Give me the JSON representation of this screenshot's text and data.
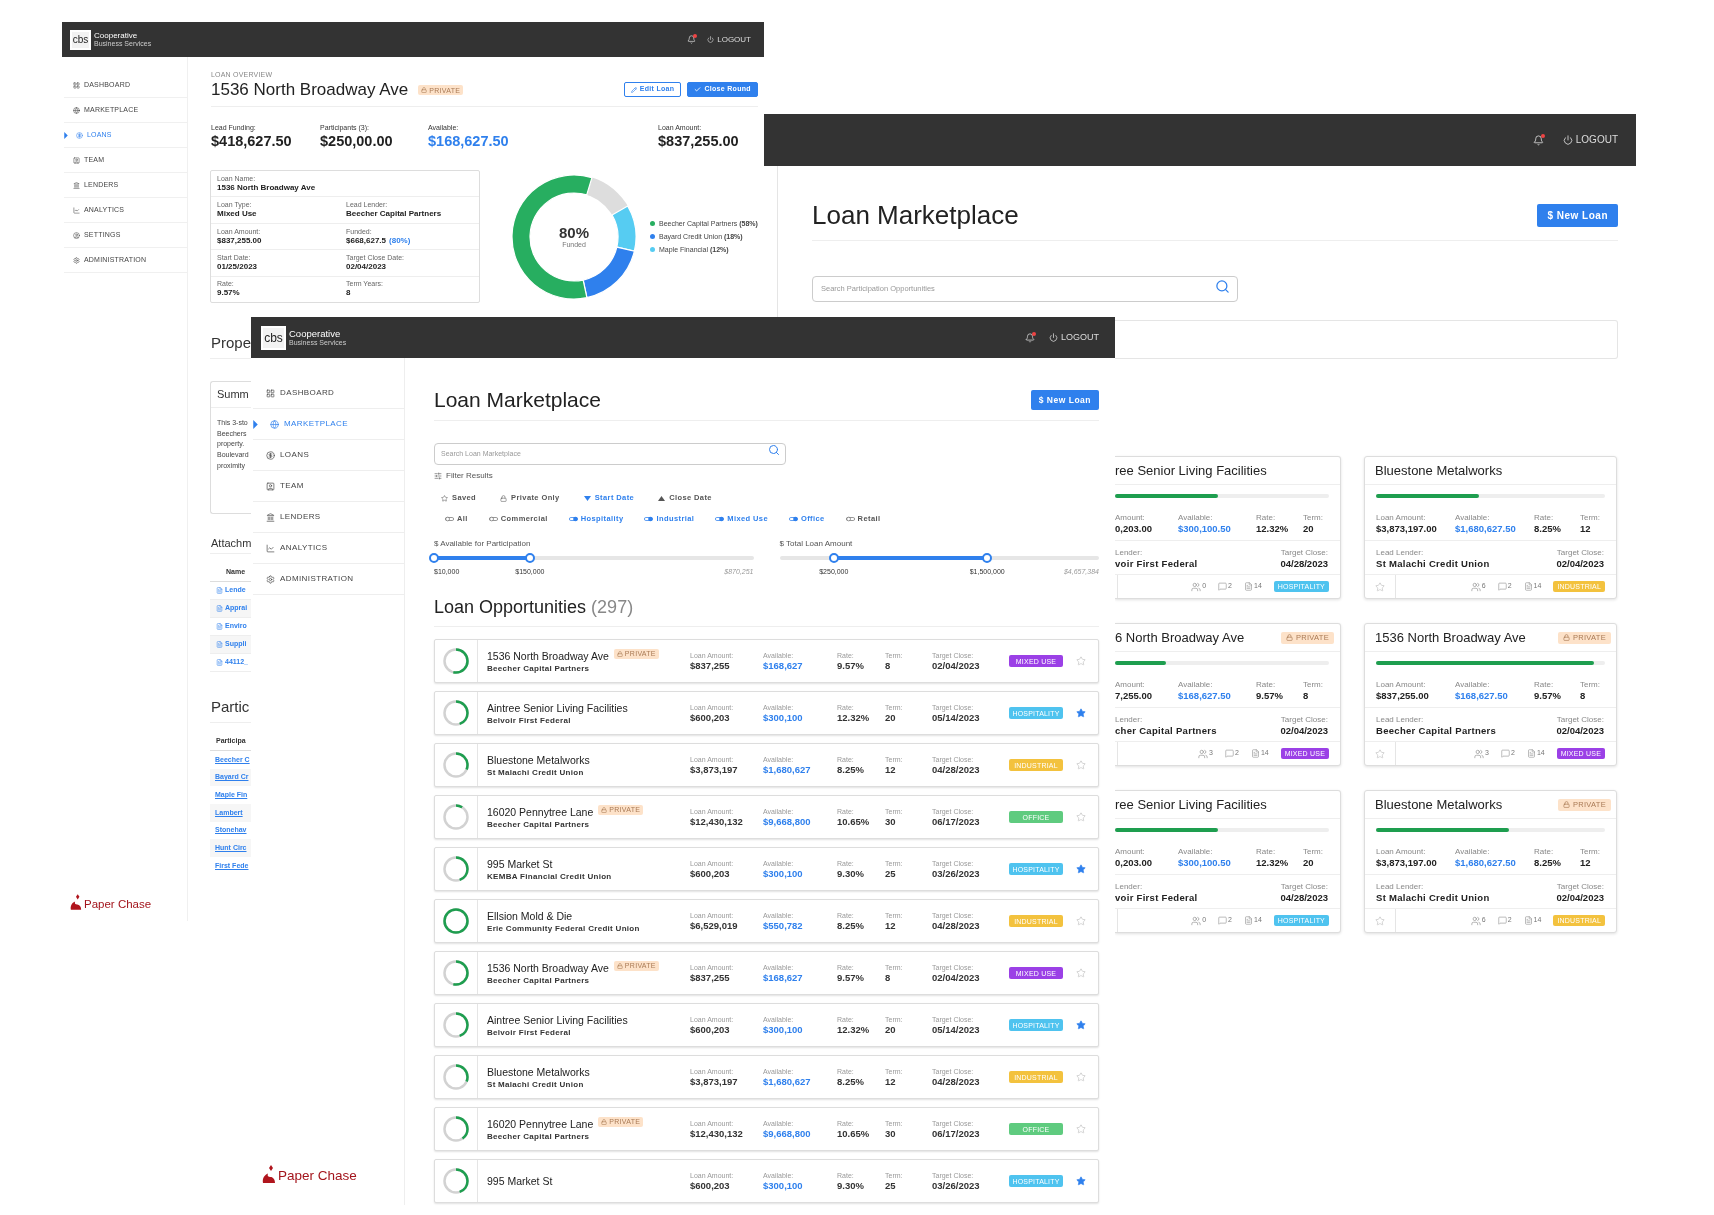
{
  "overview_window": {
    "header": {
      "logo": "cbs",
      "brand": "Cooperative",
      "tagline": "Business Services",
      "alert": true,
      "logout": "LOGOUT"
    },
    "sidebar": [
      {
        "label": "DASHBOARD",
        "selected": false
      },
      {
        "label": "MARKETPLACE",
        "selected": false
      },
      {
        "label": "LOANS",
        "selected": true
      },
      {
        "label": "TEAM",
        "selected": false
      },
      {
        "label": "LENDERS",
        "selected": false
      },
      {
        "label": "ANALYTICS",
        "selected": false
      },
      {
        "label": "SETTINGS",
        "selected": false
      },
      {
        "label": "ADMINISTRATION",
        "selected": false
      }
    ],
    "footer_logo": "Paper Chase",
    "eyebrow": "LOAN OVERVIEW",
    "title": "1536 North Broadway Ave",
    "badge": "PRIVATE",
    "buttons": [
      {
        "label": "Edit Loan",
        "kind": "outline"
      },
      {
        "label": "Close Round",
        "kind": "primary"
      }
    ],
    "stats": [
      {
        "label": "Lead Funding:",
        "value": "$418,627.50",
        "accent": false
      },
      {
        "label": "Participants (3):",
        "value": "$250,00.00",
        "accent": false
      },
      {
        "label": "Available:",
        "value": "$168,627.50",
        "accent": true
      },
      {
        "label": "Loan Amount:",
        "value": "$837,255.00",
        "accent": false
      }
    ],
    "details": [
      {
        "cells": [
          {
            "label": "Loan Name:",
            "value": "1536 North Broadway Ave"
          }
        ]
      },
      {
        "cells": [
          {
            "label": "Loan Type:",
            "value": "Mixed Use"
          },
          {
            "label": "Lead Lender:",
            "value": "Beecher Capital Partners"
          }
        ]
      },
      {
        "cells": [
          {
            "label": "Loan Amount:",
            "value": "$837,255.00"
          },
          {
            "label": "Funded:",
            "value": "$668,627.5",
            "note": "(80%)"
          }
        ]
      },
      {
        "cells": [
          {
            "label": "Start Date:",
            "value": "01/25/2023"
          },
          {
            "label": "Target Close Date:",
            "value": "02/04/2023"
          }
        ]
      },
      {
        "cells": [
          {
            "label": "Rate:",
            "value": "9.57%"
          },
          {
            "label": "Term Years:",
            "value": "8"
          }
        ]
      }
    ],
    "funding": {
      "center": "80%",
      "caption": "Funded",
      "chart_data": {
        "type": "donut",
        "categories": [
          "Beecher Capital Partners",
          "Bayard Credit Union",
          "Maple Financial"
        ],
        "values": [
          58,
          18,
          12
        ],
        "colors": [
          "#27ae60",
          "#2f80ed",
          "#56ccf2"
        ],
        "value_labels": [
          "(58%)",
          "(18%)",
          "(12%)"
        ],
        "legend": "right"
      }
    },
    "property_heading": "Prope",
    "summary": {
      "title": "Summ",
      "lines": [
        "This 3-sto",
        "Beechers",
        "property.",
        "Boulevard",
        "proximity"
      ]
    },
    "attachments": {
      "title": "Attachm",
      "column": "Name",
      "files": [
        "Lende",
        "Apprai",
        "Enviro",
        "Suppli",
        "44112_"
      ]
    },
    "participants": {
      "title": "Partic",
      "column": "Participa",
      "names": [
        "Beecher C",
        "Bayard Cr",
        "Maple Fin",
        "Lambert",
        "Stonehav",
        "Hunt Circ",
        "First Fede"
      ]
    }
  },
  "participation_window": {
    "header": {
      "alert": true,
      "logout": "LOGOUT"
    },
    "title": "Loan Marketplace",
    "action": "$ New Loan",
    "search": {
      "placeholder": "Search Participation Opportunities"
    },
    "cards": [
      {
        "title": "ree Senior Living Facilities",
        "level": 0.48,
        "stats": [
          {
            "label": "Amount:",
            "value": "0,203.00"
          },
          {
            "label": "Available:",
            "value": "$300,100.50"
          },
          {
            "label": "Rate:",
            "value": "12.32%"
          },
          {
            "label": "Term:",
            "value": "20"
          }
        ],
        "lender": {
          "label": "Lender:",
          "value": "voir First Federal"
        },
        "close": {
          "label": "Target Close:",
          "value": "04/28/2023"
        },
        "counts": [
          "0",
          "2",
          "14"
        ],
        "tag": {
          "text": "HOSPITALITY",
          "color": "#4fc3ef"
        }
      },
      {
        "title": "Bluestone Metalworks",
        "level": 0.45,
        "stats": [
          {
            "label": "Loan Amount:",
            "value": "$3,873,197.00"
          },
          {
            "label": "Available:",
            "value": "$1,680,627.50"
          },
          {
            "label": "Rate:",
            "value": "8.25%"
          },
          {
            "label": "Term:",
            "value": "12"
          }
        ],
        "lender": {
          "label": "Lead Lender:",
          "value": "St Malachi Credit Union"
        },
        "close": {
          "label": "Target Close:",
          "value": "02/04/2023"
        },
        "saved": false,
        "counts": [
          "6",
          "2",
          "14"
        ],
        "tag": {
          "text": "INDUSTRIAL",
          "color": "#f3c23e"
        }
      },
      {
        "title": "6 North Broadway Ave",
        "badge": "PRIVATE",
        "level": 0.24,
        "stats": [
          {
            "label": "Amount:",
            "value": "7,255.00"
          },
          {
            "label": "Available:",
            "value": "$168,627.50"
          },
          {
            "label": "Rate:",
            "value": "9.57%"
          },
          {
            "label": "Term:",
            "value": "8"
          }
        ],
        "lender": {
          "label": "Lender:",
          "value": "cher Capital Partners"
        },
        "close": {
          "label": "Target Close:",
          "value": "02/04/2023"
        },
        "counts": [
          "3",
          "2",
          "14"
        ],
        "tag": {
          "text": "MIXED USE",
          "color": "#9b40e6"
        }
      },
      {
        "title": "1536 North Broadway Ave",
        "badge": "PRIVATE",
        "level": 0.95,
        "stats": [
          {
            "label": "Loan Amount:",
            "value": "$837,255.00"
          },
          {
            "label": "Available:",
            "value": "$168,627.50"
          },
          {
            "label": "Rate:",
            "value": "9.57%"
          },
          {
            "label": "Term:",
            "value": "8"
          }
        ],
        "lender": {
          "label": "Lead Lender:",
          "value": "Beecher Capital Partners"
        },
        "close": {
          "label": "Target Close:",
          "value": "02/04/2023"
        },
        "saved": false,
        "counts": [
          "3",
          "2",
          "14"
        ],
        "tag": {
          "text": "MIXED USE",
          "color": "#9b40e6"
        }
      },
      {
        "title": "ree Senior Living Facilities",
        "level": 0.48,
        "stats": [
          {
            "label": "Amount:",
            "value": "0,203.00"
          },
          {
            "label": "Available:",
            "value": "$300,100.50"
          },
          {
            "label": "Rate:",
            "value": "12.32%"
          },
          {
            "label": "Term:",
            "value": "20"
          }
        ],
        "lender": {
          "label": "Lender:",
          "value": "voir First Federal"
        },
        "close": {
          "label": "Target Close:",
          "value": "04/28/2023"
        },
        "counts": [
          "0",
          "2",
          "14"
        ],
        "tag": {
          "text": "HOSPITALITY",
          "color": "#4fc3ef"
        }
      },
      {
        "title": "Bluestone Metalworks",
        "badge": "PRIVATE",
        "level": 0.58,
        "stats": [
          {
            "label": "Loan Amount:",
            "value": "$3,873,197.00"
          },
          {
            "label": "Available:",
            "value": "$1,680,627.50"
          },
          {
            "label": "Rate:",
            "value": "8.25%"
          },
          {
            "label": "Term:",
            "value": "12"
          }
        ],
        "lender": {
          "label": "Lead Lender:",
          "value": "St Malachi Credit Union"
        },
        "close": {
          "label": "Target Close:",
          "value": "02/04/2023"
        },
        "saved": false,
        "counts": [
          "6",
          "2",
          "14"
        ],
        "tag": {
          "text": "INDUSTRIAL",
          "color": "#f3c23e"
        }
      }
    ]
  },
  "marketplace_window": {
    "header": {
      "logo": "cbs",
      "brand": "Cooperative",
      "tagline": "Business Services",
      "alert": true,
      "logout": "LOGOUT"
    },
    "sidebar": [
      {
        "label": "DASHBOARD",
        "selected": false
      },
      {
        "label": "MARKETPLACE",
        "selected": true
      },
      {
        "label": "LOANS",
        "selected": false
      },
      {
        "label": "TEAM",
        "selected": false
      },
      {
        "label": "LENDERS",
        "selected": false
      },
      {
        "label": "ANALYTICS",
        "selected": false
      },
      {
        "label": "ADMINISTRATION",
        "selected": false
      }
    ],
    "footer_logo": "Paper Chase",
    "title": "Loan Marketplace",
    "action": "$ New Loan",
    "search": {
      "placeholder": "Search Loan Marketplace"
    },
    "filter_heading": "Filter Results",
    "sorts": [
      {
        "label": "Saved",
        "selected": false
      },
      {
        "label": "Private Only",
        "selected": false
      },
      {
        "label": "Start Date",
        "selected": true
      },
      {
        "label": "Close Date",
        "selected": false
      }
    ],
    "types": [
      {
        "label": "All",
        "on": false
      },
      {
        "label": "Commercial",
        "on": false
      },
      {
        "label": "Hospitality",
        "on": true
      },
      {
        "label": "Industrial",
        "on": true
      },
      {
        "label": "Mixed Use",
        "on": true
      },
      {
        "label": "Office",
        "on": true
      },
      {
        "label": "Retail",
        "on": false
      }
    ],
    "ranges": [
      {
        "label": "$ Available for Participation",
        "thumbs": [
          {
            "level": 0,
            "label": "$10,000"
          },
          {
            "level": 0.3,
            "label": "$150,000"
          }
        ],
        "max": "$870,251"
      },
      {
        "label": "$ Total Loan Amount",
        "thumbs": [
          {
            "level": 0.17,
            "label": "$250,000"
          },
          {
            "level": 0.65,
            "label": "$1,500,000"
          }
        ],
        "max": "$4,657,384"
      }
    ],
    "list_title": "Loan Opportunities",
    "count": "(297)",
    "loans": [
      {
        "level": 0.6,
        "title": "1536 North Broadway Ave",
        "badge": "PRIVATE",
        "lender": "Beecher Capital Partners",
        "cells": [
          {
            "label": "Loan Amount:",
            "value": "$837,255"
          },
          {
            "label": "Available:",
            "value": "$168,627"
          },
          {
            "label": "Rate:",
            "value": "9.57%"
          },
          {
            "label": "Term:",
            "value": "8"
          },
          {
            "label": "Target Close:",
            "value": "02/04/2023"
          }
        ],
        "tag": {
          "text": "MIXED USE",
          "color": "#9b40e6"
        },
        "saved": false
      },
      {
        "level": 0.5,
        "title": "Aintree Senior Living Facilities",
        "lender": "Belvoir First Federal",
        "cells": [
          {
            "label": "Loan Amount:",
            "value": "$600,203"
          },
          {
            "label": "Available:",
            "value": "$300,100"
          },
          {
            "label": "Rate:",
            "value": "12.32%"
          },
          {
            "label": "Term:",
            "value": "20"
          },
          {
            "label": "Target Close:",
            "value": "05/14/2023"
          }
        ],
        "tag": {
          "text": "HOSPITALITY",
          "color": "#4fc3ef"
        },
        "saved": true
      },
      {
        "level": 0.35,
        "title": "Bluestone Metalworks",
        "lender": "St Malachi Credit Union",
        "cells": [
          {
            "label": "Loan Amount:",
            "value": "$3,873,197"
          },
          {
            "label": "Available:",
            "value": "$1,680,627"
          },
          {
            "label": "Rate:",
            "value": "8.25%"
          },
          {
            "label": "Term:",
            "value": "12"
          },
          {
            "label": "Target Close:",
            "value": "04/28/2023"
          }
        ],
        "tag": {
          "text": "INDUSTRIAL",
          "color": "#f3c23e"
        },
        "saved": false
      },
      {
        "level": 0.1,
        "title": "16020 Pennytree Lane",
        "badge": "PRIVATE",
        "lender": "Beecher Capital Partners",
        "cells": [
          {
            "label": "Loan Amount:",
            "value": "$12,430,132"
          },
          {
            "label": "Available:",
            "value": "$9,668,800"
          },
          {
            "label": "Rate:",
            "value": "10.65%"
          },
          {
            "label": "Term:",
            "value": "30"
          },
          {
            "label": "Target Close:",
            "value": "06/17/2023"
          }
        ],
        "tag": {
          "text": "OFFICE",
          "color": "#5fcb7f"
        },
        "saved": false
      },
      {
        "level": 0.5,
        "title": "995 Market St",
        "lender": "KEMBA Financial Credit Union",
        "cells": [
          {
            "label": "Loan Amount:",
            "value": "$600,203"
          },
          {
            "label": "Available:",
            "value": "$300,100"
          },
          {
            "label": "Rate:",
            "value": "9.30%"
          },
          {
            "label": "Term:",
            "value": "25"
          },
          {
            "label": "Target Close:",
            "value": "03/26/2023"
          }
        ],
        "tag": {
          "text": "HOSPITALITY",
          "color": "#4fc3ef"
        },
        "saved": true
      },
      {
        "level": 1,
        "title": "Ellsion Mold & Die",
        "lender": "Erie Community Federal Credit Union",
        "cells": [
          {
            "label": "Loan Amount:",
            "value": "$6,529,019"
          },
          {
            "label": "Available:",
            "value": "$550,782"
          },
          {
            "label": "Rate:",
            "value": "8.25%"
          },
          {
            "label": "Term:",
            "value": "12"
          },
          {
            "label": "Target Close:",
            "value": "04/28/2023"
          }
        ],
        "tag": {
          "text": "INDUSTRIAL",
          "color": "#f3c23e"
        },
        "saved": false
      },
      {
        "level": 0.6,
        "title": "1536 North Broadway Ave",
        "badge": "PRIVATE",
        "lender": "Beecher Capital Partners",
        "cells": [
          {
            "label": "Loan Amount:",
            "value": "$837,255"
          },
          {
            "label": "Available:",
            "value": "$168,627"
          },
          {
            "label": "Rate:",
            "value": "9.57%"
          },
          {
            "label": "Term:",
            "value": "8"
          },
          {
            "label": "Target Close:",
            "value": "02/04/2023"
          }
        ],
        "tag": {
          "text": "MIXED USE",
          "color": "#9b40e6"
        },
        "saved": false
      },
      {
        "level": 0.5,
        "title": "Aintree Senior Living Facilities",
        "lender": "Belvoir First Federal",
        "cells": [
          {
            "label": "Loan Amount:",
            "value": "$600,203"
          },
          {
            "label": "Available:",
            "value": "$300,100"
          },
          {
            "label": "Rate:",
            "value": "12.32%"
          },
          {
            "label": "Term:",
            "value": "20"
          },
          {
            "label": "Target Close:",
            "value": "05/14/2023"
          }
        ],
        "tag": {
          "text": "HOSPITALITY",
          "color": "#4fc3ef"
        },
        "saved": true
      },
      {
        "level": 0.35,
        "title": "Bluestone Metalworks",
        "lender": "St Malachi Credit Union",
        "cells": [
          {
            "label": "Loan Amount:",
            "value": "$3,873,197"
          },
          {
            "label": "Available:",
            "value": "$1,680,627"
          },
          {
            "label": "Rate:",
            "value": "8.25%"
          },
          {
            "label": "Term:",
            "value": "12"
          },
          {
            "label": "Target Close:",
            "value": "04/28/2023"
          }
        ],
        "tag": {
          "text": "INDUSTRIAL",
          "color": "#f3c23e"
        },
        "saved": false
      },
      {
        "level": 0.45,
        "title": "16020 Pennytree Lane",
        "badge": "PRIVATE",
        "lender": "Beecher Capital Partners",
        "cells": [
          {
            "label": "Loan Amount:",
            "value": "$12,430,132"
          },
          {
            "label": "Available:",
            "value": "$9,668,800"
          },
          {
            "label": "Rate:",
            "value": "10.65%"
          },
          {
            "label": "Term:",
            "value": "30"
          },
          {
            "label": "Target Close:",
            "value": "06/17/2023"
          }
        ],
        "tag": {
          "text": "OFFICE",
          "color": "#5fcb7f"
        },
        "saved": false
      },
      {
        "level": 0.5,
        "title": "995 Market St",
        "cells": [
          {
            "label": "Loan Amount:",
            "value": "$600,203"
          },
          {
            "label": "Available:",
            "value": "$300,100"
          },
          {
            "label": "Rate:",
            "value": "9.30%"
          },
          {
            "label": "Term:",
            "value": "25"
          },
          {
            "label": "Target Close:",
            "value": "03/26/2023"
          }
        ],
        "tag": {
          "text": "HOSPITALITY",
          "color": "#4fc3ef"
        },
        "saved": true
      }
    ]
  }
}
